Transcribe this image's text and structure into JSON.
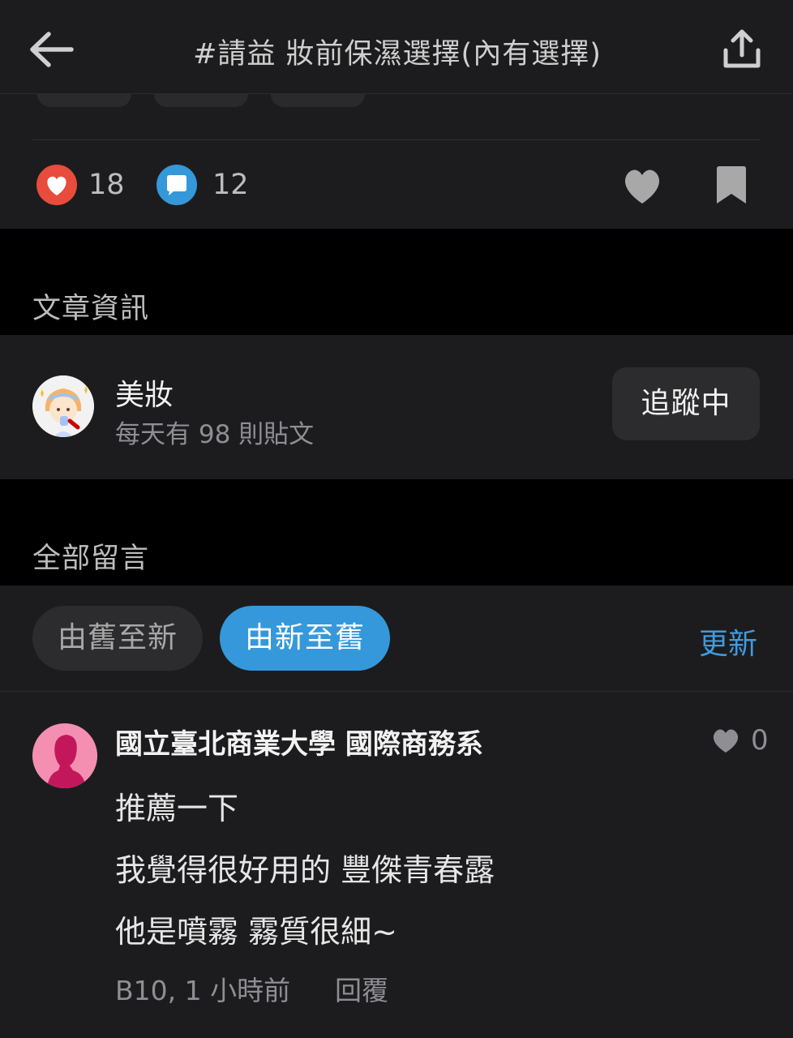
{
  "header": {
    "title": "#請益 妝前保濕選擇(內有選擇)",
    "back_icon": "arrow-left-icon",
    "share_icon": "share-upload-icon"
  },
  "stats": {
    "likes": "18",
    "comments": "12",
    "like_color": "#e74c3c",
    "comment_color": "#3498db"
  },
  "info_section": {
    "label": "文章資訊"
  },
  "board": {
    "name": "美妝",
    "subtitle": "每天有 98 則貼文",
    "follow_label": "追蹤中"
  },
  "comments_section": {
    "label": "全部留言",
    "sort_old_to_new": "由舊至新",
    "sort_new_to_old": "由新至舊",
    "refresh": "更新",
    "active_sort": "由新至舊",
    "accent_color": "#3498db"
  },
  "comment": {
    "author": "國立臺北商業大學 國際商務系",
    "likes": "0",
    "lines": [
      "推薦一下",
      "我覺得很好用的 豐傑青春露",
      "他是噴霧 霧質很細~"
    ],
    "meta": "B10, 1 小時前",
    "reply": "回覆"
  }
}
